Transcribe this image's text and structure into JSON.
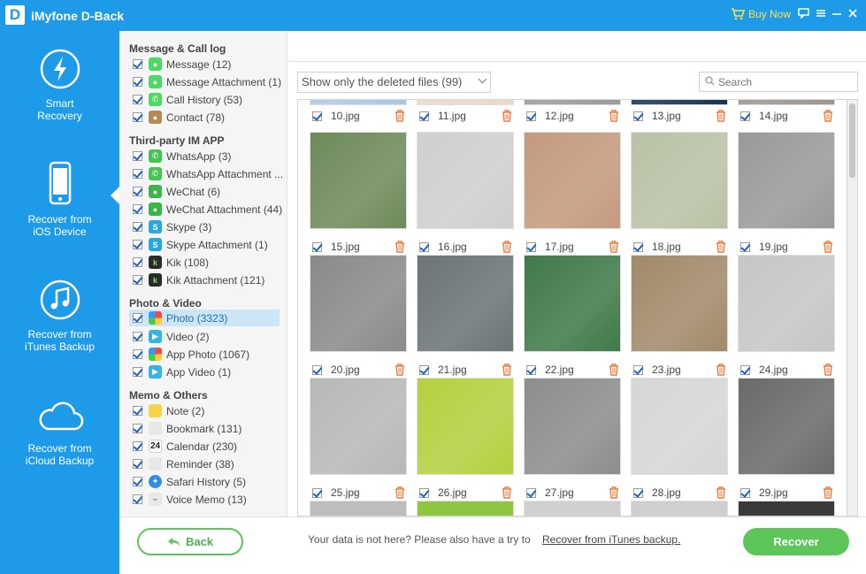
{
  "app": {
    "logo_letter": "D",
    "title": "iMyfone D-Back",
    "buy_now": "Buy Now"
  },
  "window_controls": [
    "feedback-icon",
    "menu-icon",
    "minimize-icon",
    "close-icon"
  ],
  "nav": {
    "items": [
      {
        "label_1": "Smart",
        "label_2": "Recovery",
        "icon": "lightning-icon"
      },
      {
        "label_1": "Recover from",
        "label_2": "iOS Device",
        "icon": "iphone-icon",
        "active": true
      },
      {
        "label_1": "Recover from",
        "label_2": "iTunes Backup",
        "icon": "music-note-icon"
      },
      {
        "label_1": "Recover from",
        "label_2": "iCloud Backup",
        "icon": "cloud-icon"
      }
    ]
  },
  "categories": {
    "groups": [
      {
        "title": "Message & Call log",
        "items": [
          {
            "label": "Message (12)",
            "icon": "message-icon",
            "color": "#4cd964"
          },
          {
            "label": "Message Attachment (1)",
            "icon": "message-icon",
            "color": "#4cd964"
          },
          {
            "label": "Call History (53)",
            "icon": "phone-icon",
            "color": "#4cd964"
          },
          {
            "label": "Contact (78)",
            "icon": "contact-icon",
            "color": "#b58a57"
          }
        ]
      },
      {
        "title": "Third-party IM APP",
        "items": [
          {
            "label": "WhatsApp (3)",
            "icon": "whatsapp-icon",
            "color": "#43c554"
          },
          {
            "label": "WhatsApp Attachment ...",
            "icon": "whatsapp-icon",
            "color": "#43c554"
          },
          {
            "label": "WeChat (6)",
            "icon": "wechat-icon",
            "color": "#3bb54a"
          },
          {
            "label": "WeChat Attachment (44)",
            "icon": "wechat-icon",
            "color": "#3bb54a"
          },
          {
            "label": "Skype (3)",
            "icon": "skype-icon",
            "color": "#27a8e0"
          },
          {
            "label": "Skype Attachment (1)",
            "icon": "skype-icon",
            "color": "#27a8e0"
          },
          {
            "label": "Kik (108)",
            "icon": "kik-icon",
            "color": "#2b2b2b"
          },
          {
            "label": "Kik Attachment (121)",
            "icon": "kik-icon",
            "color": "#2b2b2b"
          }
        ]
      },
      {
        "title": "Photo & Video",
        "items": [
          {
            "label": "Photo (3323)",
            "icon": "photos-icon",
            "color": "#f2a33a",
            "selected": true
          },
          {
            "label": "Video (2)",
            "icon": "video-clapper-icon",
            "color": "#39b3e6"
          },
          {
            "label": "App Photo (1067)",
            "icon": "photos-icon",
            "color": "#f2a33a"
          },
          {
            "label": "App Video (1)",
            "icon": "video-clapper-icon",
            "color": "#39b3e6"
          }
        ]
      },
      {
        "title": "Memo & Others",
        "items": [
          {
            "label": "Note (2)",
            "icon": "note-icon",
            "color": "#f7d54b"
          },
          {
            "label": "Bookmark (131)",
            "icon": "bookmark-icon",
            "color": "#e8e8e8"
          },
          {
            "label": "Calendar (230)",
            "icon": "calendar-icon",
            "color": "#ffffff",
            "glyph": "24"
          },
          {
            "label": "Reminder (38)",
            "icon": "reminder-icon",
            "color": "#e8e8e8"
          },
          {
            "label": "Safari History (5)",
            "icon": "safari-icon",
            "color": "#2f8fe6"
          },
          {
            "label": "Voice Memo (13)",
            "icon": "voice-memo-icon",
            "color": "#e8e8e8"
          }
        ]
      }
    ]
  },
  "toolbar": {
    "filter_value": "Show only the deleted files (99)",
    "search_placeholder": "Search"
  },
  "gallery": {
    "rows": [
      [
        "10.jpg",
        "11.jpg",
        "12.jpg",
        "13.jpg",
        "14.jpg"
      ],
      [
        "15.jpg",
        "16.jpg",
        "17.jpg",
        "18.jpg",
        "19.jpg"
      ],
      [
        "20.jpg",
        "21.jpg",
        "22.jpg",
        "23.jpg",
        "24.jpg"
      ],
      [
        "25.jpg",
        "26.jpg",
        "27.jpg",
        "28.jpg",
        "29.jpg"
      ]
    ],
    "thumb_tones": [
      [
        "#a8c8e8",
        "#e9d9c8",
        "#9a9a96",
        "#123356",
        "#9b9590"
      ],
      [
        "#6e8a5a",
        "#cfcfcf",
        "#c49a7e",
        "#b9c2a6",
        "#9a9a9a"
      ],
      [
        "#8a8a88",
        "#6c7478",
        "#3f7a4a",
        "#a18a6a",
        "#c6c6c6"
      ],
      [
        "#b8b8b8",
        "#b5d040",
        "#8d8d8d",
        "#d6d6d6",
        "#6a6a6a"
      ]
    ]
  },
  "footer": {
    "back_label": "Back",
    "hint": "Your data is not here? Please also have a try to",
    "link": "Recover from iTunes backup.",
    "recover_label": "Recover"
  }
}
